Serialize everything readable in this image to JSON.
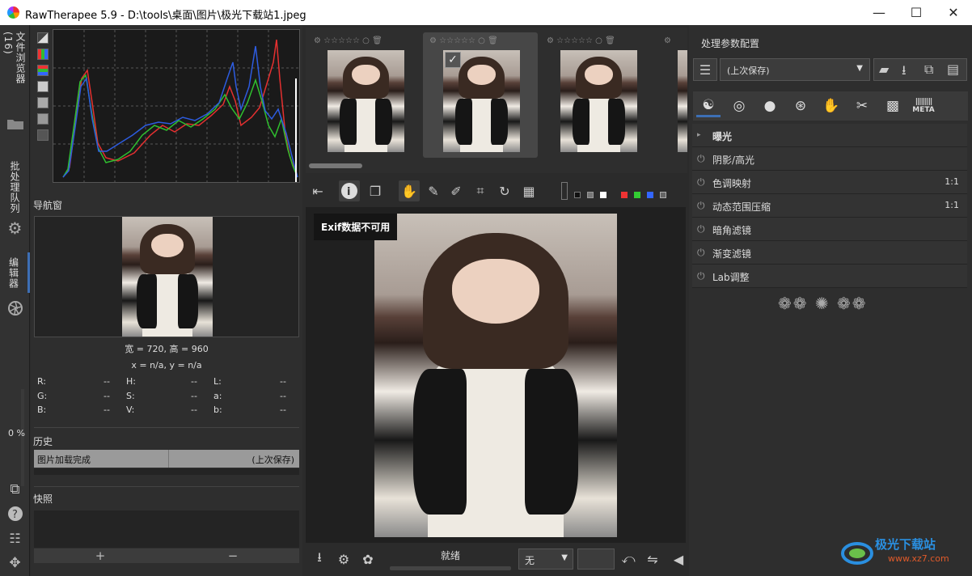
{
  "window": {
    "title": "RawTherapee 5.9 - D:\\tools\\桌面\\图片\\极光下载站1.jpeg",
    "minimize": "—",
    "maximize": "☐",
    "close": "✕"
  },
  "vtabs": {
    "file_browser": "文件浏览器 (16)",
    "batch_queue": "批处理队列",
    "editor": "编辑器",
    "progress": "0 %"
  },
  "navigator": {
    "title": "导航窗",
    "size_text": "宽 = 720, 高 = 960",
    "coords_text": "x = n/a, y = n/a",
    "values": [
      {
        "label": "R:",
        "value": "--"
      },
      {
        "label": "H:",
        "value": "--"
      },
      {
        "label": "L:",
        "value": "--"
      },
      {
        "label": "G:",
        "value": "--"
      },
      {
        "label": "S:",
        "value": "--"
      },
      {
        "label": "a:",
        "value": "--"
      },
      {
        "label": "B:",
        "value": "--"
      },
      {
        "label": "V:",
        "value": "--"
      },
      {
        "label": "b:",
        "value": "--"
      }
    ]
  },
  "history": {
    "title": "历史",
    "row": {
      "action": "图片加载完成",
      "value": "(上次保存)"
    }
  },
  "snapshot": {
    "title": "快照",
    "add": "+",
    "remove": "−"
  },
  "filmstrip": {
    "stars": "☆☆☆☆☆"
  },
  "viewer": {
    "exif_msg": "Exif数据不可用"
  },
  "status": {
    "ready": "就绪",
    "none_option": "无"
  },
  "right": {
    "title": "处理参数配置",
    "profile": "(上次保存)",
    "meta_tab": "META",
    "panels": [
      {
        "label": "曝光",
        "value": "",
        "expander": "▸"
      },
      {
        "label": "阴影/高光",
        "value": ""
      },
      {
        "label": "色调映射",
        "value": "1:1"
      },
      {
        "label": "动态范围压缩",
        "value": "1:1"
      },
      {
        "label": "暗角滤镜",
        "value": ""
      },
      {
        "label": "渐变滤镜",
        "value": ""
      },
      {
        "label": "Lab调整",
        "value": ""
      }
    ]
  },
  "watermark": {
    "name": "极光下载站",
    "url": "www.xz7.com"
  },
  "colors": {
    "accent_blue": "#3d6fb5",
    "bg": "#2b2b2b"
  }
}
